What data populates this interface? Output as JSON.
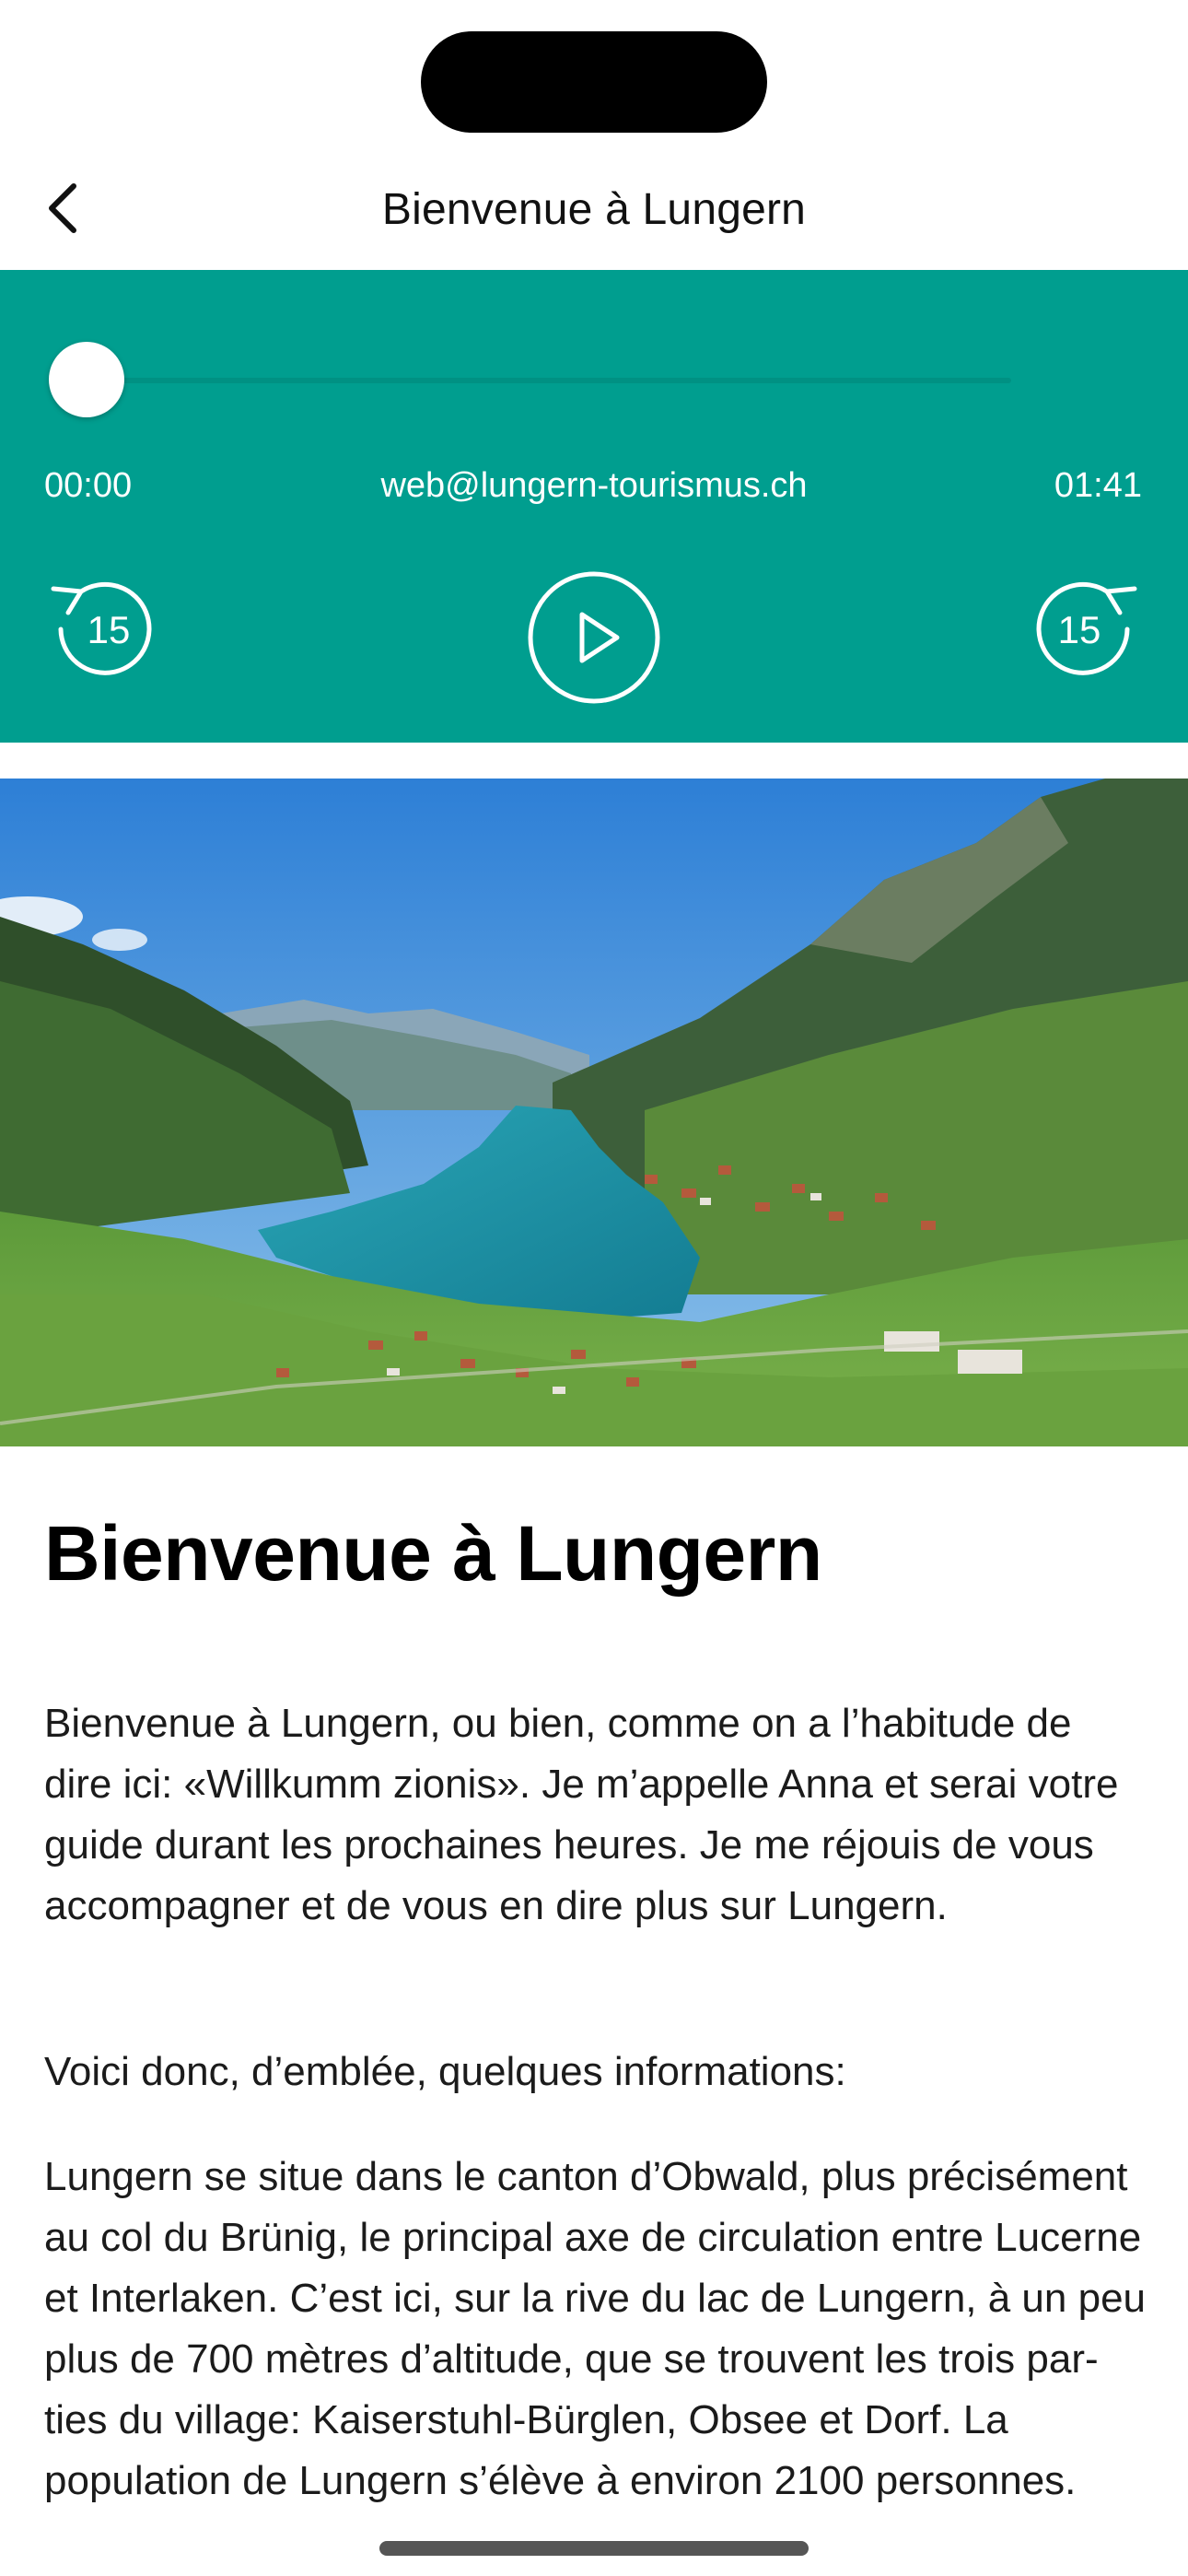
{
  "nav": {
    "title": "Bienvenue à Lungern",
    "back_icon": "chevron-left-icon"
  },
  "player": {
    "progress": 0,
    "time_current": "00:00",
    "time_total": "01:41",
    "email": "web@lungern-tourismus.ch",
    "rewind_label": "15",
    "forward_label": "15",
    "background_color": "#009e8f",
    "rewind_icon": "rewind-15-icon",
    "play_icon": "play-icon",
    "forward_icon": "forward-15-icon"
  },
  "hero": {
    "icon": "lake-landscape-image"
  },
  "article": {
    "title": "Bienvenue à Lungern",
    "paragraphs": [
      "Bienvenue à Lungern, ou bien, comme on a l’habitude de dire ici: «Willkumm zionis». Je m’appelle Anna et serai votre guide durant les prochaines heures. Je me réjouis de vous accompagner et de vous en dire plus sur Lungern.",
      "Voici donc, d’emblée, quelques informations:",
      "Lungern se situe dans le canton d’Obwald, plus précisément au col du Brünig, le principal axe de circulation entre Lucerne et Interlaken. C’est ici, sur la rive du lac de Lungern, à un peu plus de 700 mètres d’altitude, que se trouvent les trois par-ties du village: Kaiserstuhl-Bürglen, Obsee et Dorf. La population de Lungern s’élève à environ 2100 personnes."
    ]
  }
}
